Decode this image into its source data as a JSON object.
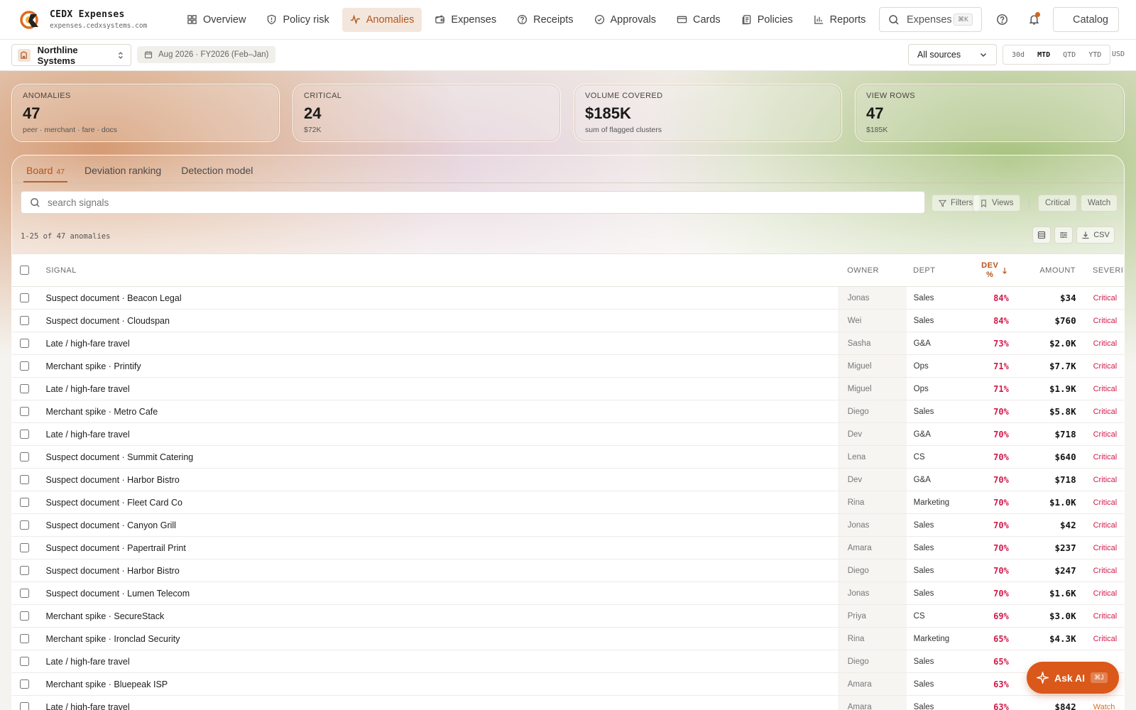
{
  "app": {
    "title": "CEDX Expenses",
    "domain": "expenses.cedxsystems.com"
  },
  "nav": [
    {
      "label": "Overview",
      "icon": "grid-icon"
    },
    {
      "label": "Policy risk",
      "icon": "shield-icon"
    },
    {
      "label": "Anomalies",
      "icon": "pulse-icon",
      "active": true
    },
    {
      "label": "Expenses",
      "icon": "wallet-icon"
    },
    {
      "label": "Receipts",
      "icon": "help-circle-icon"
    },
    {
      "label": "Approvals",
      "icon": "check-circle-icon"
    },
    {
      "label": "Cards",
      "icon": "card-icon"
    },
    {
      "label": "Policies",
      "icon": "document-icon"
    },
    {
      "label": "Reports",
      "icon": "bar-chart-icon"
    }
  ],
  "search": {
    "label": "Expenses",
    "shortcut": "⌘K"
  },
  "catalog": {
    "label": "Catalog"
  },
  "org": {
    "name": "Northline Systems"
  },
  "period": {
    "label": "Aug 2026 · FY2026 (Feb–Jan)"
  },
  "source": {
    "selected": "All sources"
  },
  "ranges": [
    {
      "label": "30d"
    },
    {
      "label": "MTD",
      "active": true
    },
    {
      "label": "QTD"
    },
    {
      "label": "YTD"
    }
  ],
  "currency": "USD",
  "stats": [
    {
      "label": "ANOMALIES",
      "value": "47",
      "sub": "peer · merchant · fare · docs"
    },
    {
      "label": "CRITICAL",
      "value": "24",
      "sub": "$72K"
    },
    {
      "label": "VOLUME COVERED",
      "value": "$185K",
      "sub": "sum of flagged clusters"
    },
    {
      "label": "VIEW ROWS",
      "value": "47",
      "sub": "$185K"
    }
  ],
  "tabs": [
    {
      "label": "Board",
      "count": "47",
      "active": true
    },
    {
      "label": "Deviation ranking"
    },
    {
      "label": "Detection model"
    }
  ],
  "filter": {
    "placeholder": "search signals",
    "filters": "Filters",
    "views": "Views",
    "critical": "Critical",
    "watch": "Watch"
  },
  "list": {
    "count_text": "1-25 of 47 anomalies",
    "csv": "CSV"
  },
  "table": {
    "headers": {
      "signal": "SIGNAL",
      "owner": "OWNER",
      "dept": "DEPT",
      "dev_a": "DEV",
      "dev_b": "%",
      "amount": "AMOUNT",
      "severity": "SEVERITY"
    },
    "rows": [
      {
        "signal": "Suspect document · Beacon Legal",
        "owner": "Jonas",
        "dept": "Sales",
        "dev": "84%",
        "amount": "$34",
        "severity": "Critical"
      },
      {
        "signal": "Suspect document · Cloudspan",
        "owner": "Wei",
        "dept": "Sales",
        "dev": "84%",
        "amount": "$760",
        "severity": "Critical"
      },
      {
        "signal": "Late / high-fare travel",
        "owner": "Sasha",
        "dept": "G&A",
        "dev": "73%",
        "amount": "$2.0K",
        "severity": "Critical"
      },
      {
        "signal": "Merchant spike · Printify",
        "owner": "Miguel",
        "dept": "Ops",
        "dev": "71%",
        "amount": "$7.7K",
        "severity": "Critical"
      },
      {
        "signal": "Late / high-fare travel",
        "owner": "Miguel",
        "dept": "Ops",
        "dev": "71%",
        "amount": "$1.9K",
        "severity": "Critical"
      },
      {
        "signal": "Merchant spike · Metro Cafe",
        "owner": "Diego",
        "dept": "Sales",
        "dev": "70%",
        "amount": "$5.8K",
        "severity": "Critical"
      },
      {
        "signal": "Late / high-fare travel",
        "owner": "Dev",
        "dept": "G&A",
        "dev": "70%",
        "amount": "$718",
        "severity": "Critical"
      },
      {
        "signal": "Suspect document · Summit Catering",
        "owner": "Lena",
        "dept": "CS",
        "dev": "70%",
        "amount": "$640",
        "severity": "Critical"
      },
      {
        "signal": "Suspect document · Harbor Bistro",
        "owner": "Dev",
        "dept": "G&A",
        "dev": "70%",
        "amount": "$718",
        "severity": "Critical"
      },
      {
        "signal": "Suspect document · Fleet Card Co",
        "owner": "Rina",
        "dept": "Marketing",
        "dev": "70%",
        "amount": "$1.0K",
        "severity": "Critical"
      },
      {
        "signal": "Suspect document · Canyon Grill",
        "owner": "Jonas",
        "dept": "Sales",
        "dev": "70%",
        "amount": "$42",
        "severity": "Critical"
      },
      {
        "signal": "Suspect document · Papertrail Print",
        "owner": "Amara",
        "dept": "Sales",
        "dev": "70%",
        "amount": "$237",
        "severity": "Critical"
      },
      {
        "signal": "Suspect document · Harbor Bistro",
        "owner": "Diego",
        "dept": "Sales",
        "dev": "70%",
        "amount": "$247",
        "severity": "Critical"
      },
      {
        "signal": "Suspect document · Lumen Telecom",
        "owner": "Jonas",
        "dept": "Sales",
        "dev": "70%",
        "amount": "$1.6K",
        "severity": "Critical"
      },
      {
        "signal": "Merchant spike · SecureStack",
        "owner": "Priya",
        "dept": "CS",
        "dev": "69%",
        "amount": "$3.0K",
        "severity": "Critical"
      },
      {
        "signal": "Merchant spike · Ironclad Security",
        "owner": "Rina",
        "dept": "Marketing",
        "dev": "65%",
        "amount": "$4.3K",
        "severity": "Critical"
      },
      {
        "signal": "Late / high-fare travel",
        "owner": "Diego",
        "dept": "Sales",
        "dev": "65%",
        "amount": "",
        "severity": ""
      },
      {
        "signal": "Merchant spike · Bluepeak ISP",
        "owner": "Amara",
        "dept": "Sales",
        "dev": "63%",
        "amount": "",
        "severity": ""
      },
      {
        "signal": "Late / high-fare travel",
        "owner": "Amara",
        "dept": "Sales",
        "dev": "63%",
        "amount": "$842",
        "severity": "Watch"
      }
    ]
  },
  "ask_ai": {
    "label": "Ask AI",
    "shortcut": "⌘J"
  }
}
